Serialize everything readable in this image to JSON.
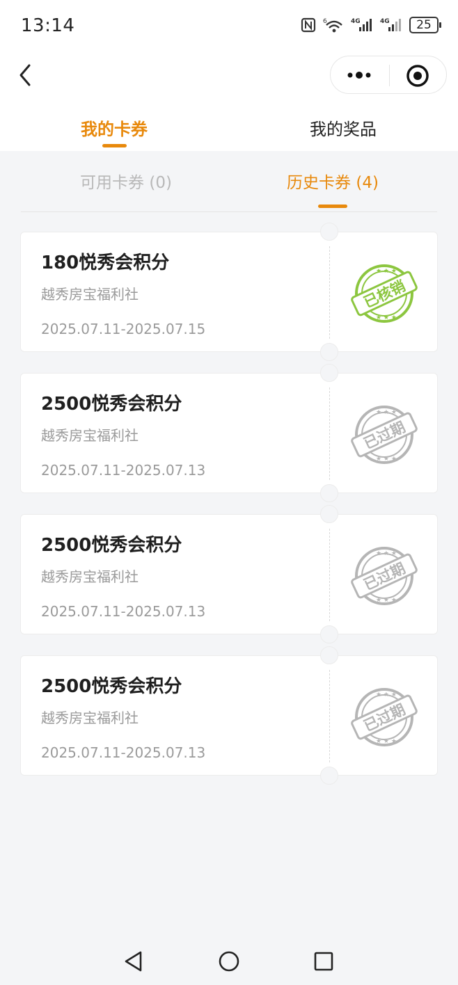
{
  "status_bar": {
    "time": "13:14",
    "network_1": "4G",
    "network_2": "4G",
    "battery": "25",
    "icons": [
      "nfc-icon",
      "wifi-icon",
      "signal-icon",
      "signal-icon",
      "battery-icon"
    ]
  },
  "nav": {
    "back_icon": "chevron-left-icon",
    "more_icon": "more-dots-icon",
    "target_icon": "target-icon"
  },
  "main_tabs": [
    {
      "label": "我的卡券",
      "active": true
    },
    {
      "label": "我的奖品",
      "active": false
    }
  ],
  "sub_tabs": [
    {
      "label": "可用卡券 (0)",
      "active": false
    },
    {
      "label": "历史卡券 (4)",
      "active": true
    }
  ],
  "coupons": [
    {
      "title": "180悦秀会积分",
      "merchant": "越秀房宝福利社",
      "dates": "2025.07.11-2025.07.15",
      "stamp": "已核销"
    },
    {
      "title": "2500悦秀会积分",
      "merchant": "越秀房宝福利社",
      "dates": "2025.07.11-2025.07.13",
      "stamp": "已过期"
    },
    {
      "title": "2500悦秀会积分",
      "merchant": "越秀房宝福利社",
      "dates": "2025.07.11-2025.07.13",
      "stamp": "已过期"
    },
    {
      "title": "2500悦秀会积分",
      "merchant": "越秀房宝福利社",
      "dates": "2025.07.11-2025.07.13",
      "stamp": "已过期"
    }
  ],
  "colors": {
    "accent": "#e8890c",
    "redeemed_stamp": "#8cc63f",
    "expired_stamp": "#b5b5b5"
  },
  "system_nav": [
    "back-triangle-icon",
    "home-circle-icon",
    "recents-square-icon"
  ]
}
